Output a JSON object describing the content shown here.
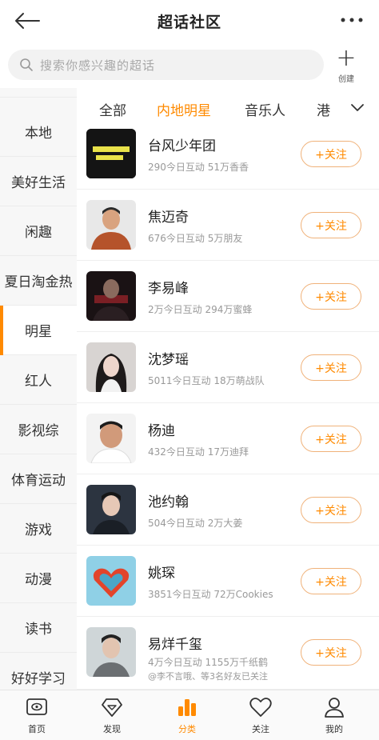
{
  "header": {
    "title": "超话社区",
    "back_icon": "back-arrow-icon",
    "more_icon": "more-dots-icon"
  },
  "search": {
    "placeholder": "搜索你感兴趣的超话",
    "create_label": "创建"
  },
  "sidebar": {
    "items": [
      {
        "label": "本地"
      },
      {
        "label": "美好生活"
      },
      {
        "label": "闲趣"
      },
      {
        "label": "夏日淘金热"
      },
      {
        "label": "明星",
        "active": true
      },
      {
        "label": "红人"
      },
      {
        "label": "影视综"
      },
      {
        "label": "体育运动"
      },
      {
        "label": "游戏"
      },
      {
        "label": "动漫"
      },
      {
        "label": "读书"
      },
      {
        "label": "好好学习"
      }
    ]
  },
  "tabs": {
    "items": [
      "全部",
      "内地明星",
      "音乐人",
      "港"
    ],
    "active_index": 1
  },
  "follow_label": "+关注",
  "list": [
    {
      "name": "台风少年团",
      "stats": "290今日互动 51万香香"
    },
    {
      "name": "焦迈奇",
      "stats": "676今日互动 5万朋友"
    },
    {
      "name": "李易峰",
      "stats": "2万今日互动 294万蜜蜂"
    },
    {
      "name": "沈梦瑶",
      "stats": "5011今日互动 18万萌战队"
    },
    {
      "name": "杨迪",
      "stats": "432今日互动 17万迪拜"
    },
    {
      "name": "池约翰",
      "stats": "504今日互动 2万大姜"
    },
    {
      "name": "姚琛",
      "stats": "3851今日互动 72万Cookies"
    },
    {
      "name": "易烊千玺",
      "stats": "4万今日互动 1155万千纸鹤",
      "friends": "@李不言哦、等3名好友已关注"
    }
  ],
  "bottom_nav": [
    {
      "label": "首页"
    },
    {
      "label": "发现"
    },
    {
      "label": "分类",
      "active": true
    },
    {
      "label": "关注"
    },
    {
      "label": "我的"
    }
  ],
  "colors": {
    "accent": "#ff8a00",
    "follow_border": "#f0b27a"
  }
}
